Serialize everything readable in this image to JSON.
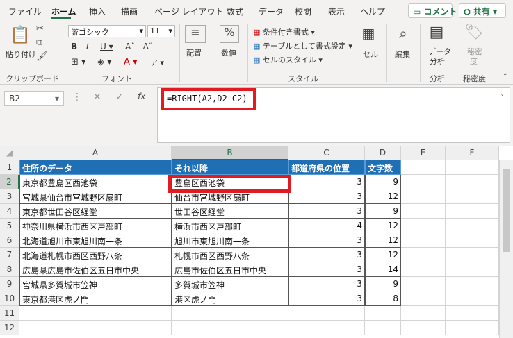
{
  "tabs": [
    "ファイル",
    "ホーム",
    "挿入",
    "描画",
    "ページ レイアウト",
    "数式",
    "データ",
    "校閲",
    "表示",
    "ヘルプ"
  ],
  "active_tab": "ホーム",
  "comment_button": "コメント",
  "share_button": "共有",
  "ribbon": {
    "clipboard": {
      "paste": "貼り付け",
      "label": "クリップボード"
    },
    "font": {
      "name": "游ゴシック",
      "size": "11",
      "label": "フォント"
    },
    "alignment": {
      "label": "配置"
    },
    "number": {
      "label": "数値"
    },
    "styles": {
      "conditional": "条件付き書式",
      "table": "テーブルとして書式設定",
      "cell_styles": "セルのスタイル",
      "label": "スタイル"
    },
    "cells": {
      "label": "セル"
    },
    "editing": {
      "label": "編集"
    },
    "analysis": {
      "data_analysis_1": "データ",
      "data_analysis_2": "分析",
      "label": "分析"
    },
    "sensitivity": {
      "label_1": "秘密",
      "label_2": "度",
      "group": "秘密度"
    }
  },
  "name_box": "B2",
  "formula": "=RIGHT(A2,D2-C2)",
  "columns": [
    "A",
    "B",
    "C",
    "D",
    "E",
    "F"
  ],
  "rows": [
    "1",
    "2",
    "3",
    "4",
    "5",
    "6",
    "7",
    "8",
    "9",
    "10",
    "11",
    "12"
  ],
  "table": {
    "headers": [
      "住所のデータ",
      "それ以降",
      "都道府県の位置",
      "文字数"
    ],
    "data": [
      [
        "東京都豊島区西池袋",
        "豊島区西池袋",
        "3",
        "9"
      ],
      [
        "宮城県仙台市宮城野区扇町",
        "仙台市宮城野区扇町",
        "3",
        "12"
      ],
      [
        "東京都世田谷区経堂",
        "世田谷区経堂",
        "3",
        "9"
      ],
      [
        "神奈川県横浜市西区戸部町",
        "横浜市西区戸部町",
        "4",
        "12"
      ],
      [
        "北海道旭川市東旭川南一条",
        "旭川市東旭川南一条",
        "3",
        "12"
      ],
      [
        "北海道札幌市西区西野八条",
        "札幌市西区西野八条",
        "3",
        "12"
      ],
      [
        "広島県広島市佐伯区五日市中央",
        "広島市佐伯区五日市中央",
        "3",
        "14"
      ],
      [
        "宮城県多賀城市笠神",
        "多賀城市笠神",
        "3",
        "9"
      ],
      [
        "東京都港区虎ノ門",
        "港区虎ノ門",
        "3",
        "8"
      ]
    ]
  },
  "colors": {
    "accent": "#217346",
    "header_fill": "#1f6fb4",
    "highlight": "#e21a22"
  }
}
